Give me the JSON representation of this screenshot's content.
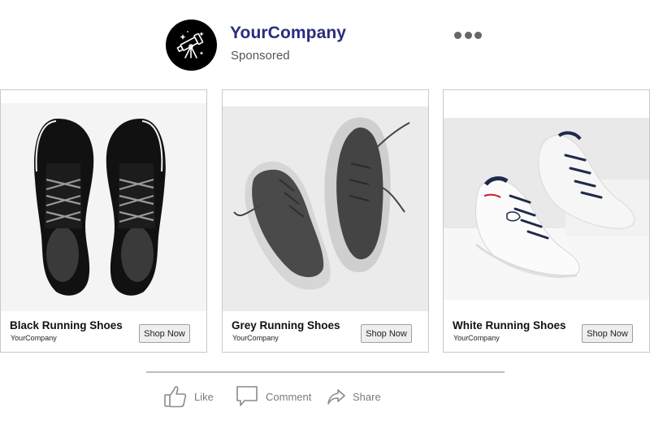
{
  "header": {
    "company_name": "YourCompany",
    "sponsored_label": "Sponsored",
    "avatar_icon": "telescope-icon",
    "more_icon": "more-options-icon"
  },
  "cards": [
    {
      "title": "Black Running Shoes",
      "subtitle": "YourCompany",
      "button": "Shop Now",
      "image": "black-running-shoes-image"
    },
    {
      "title": "Grey Running Shoes",
      "subtitle": "YourCompany",
      "button": "Shop Now",
      "image": "grey-running-shoes-image"
    },
    {
      "title": "White Running Shoes",
      "subtitle": "YourCompany",
      "button": "Shop Now",
      "image": "white-running-shoes-image"
    }
  ],
  "actions": {
    "like": {
      "label": "Like",
      "icon": "thumbs-up-icon"
    },
    "comment": {
      "label": "Comment",
      "icon": "comment-icon"
    },
    "share": {
      "label": "Share",
      "icon": "share-icon"
    }
  },
  "colors": {
    "brand_name": "#2a2d7c",
    "avatar_bg": "#000000",
    "muted_text": "#7a7a7a",
    "card_border": "#c9c9c9"
  }
}
